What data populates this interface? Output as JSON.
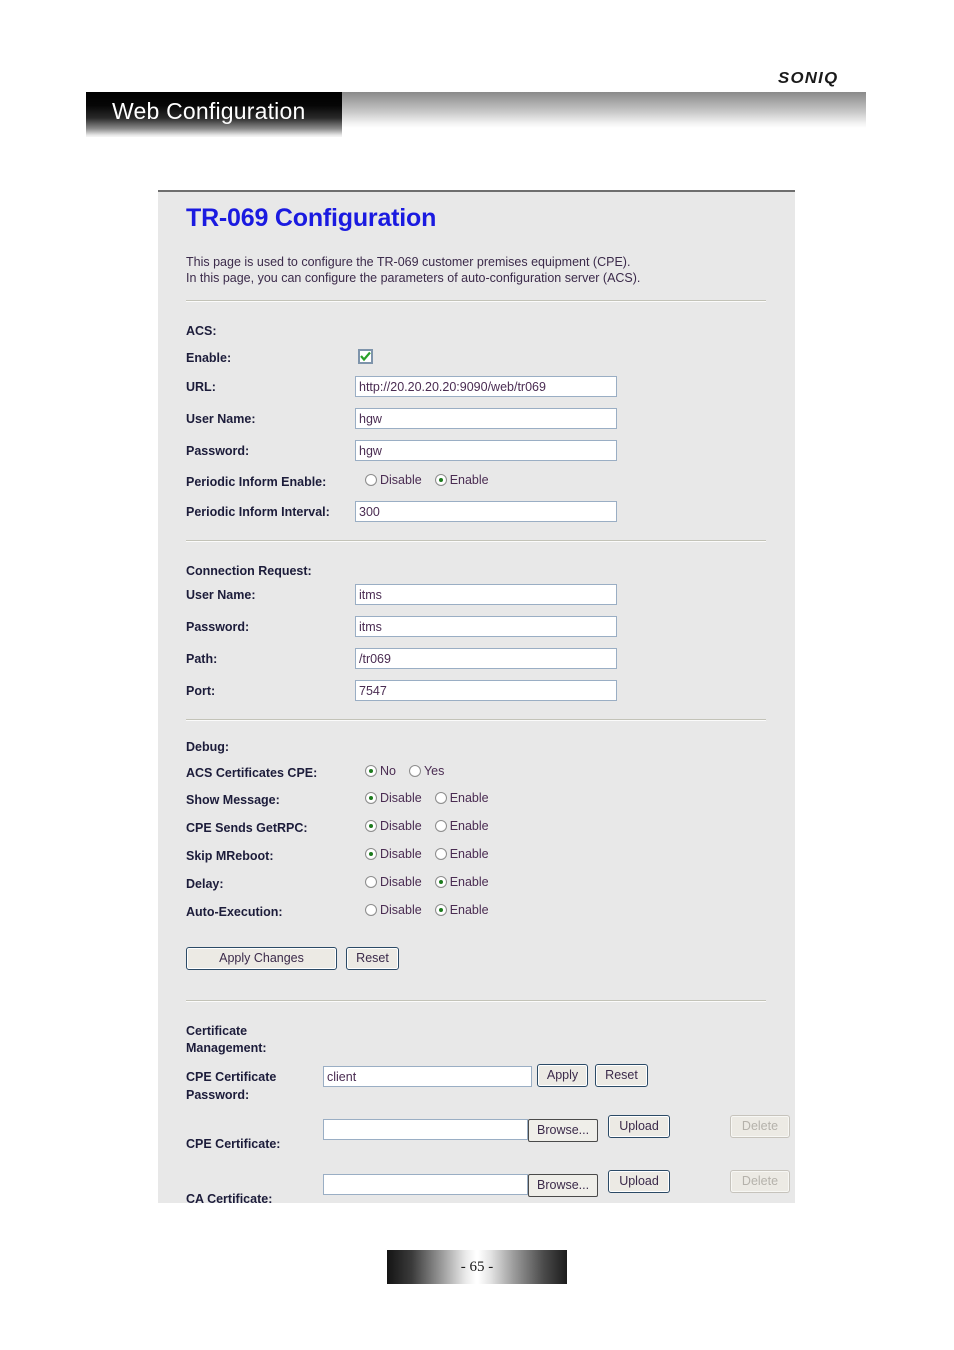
{
  "header": {
    "logo_text": "SONIQ",
    "banner_title": "Web Configuration"
  },
  "page": {
    "title": "TR-069 Configuration",
    "intro_line1": "This page is used to configure the TR-069 customer premises equipment (CPE).",
    "intro_line2": "In this page, you can configure the parameters of auto-configuration server (ACS)."
  },
  "acs": {
    "section_label": "ACS:",
    "enable_label": "Enable:",
    "enable_checked": true,
    "url_label": "URL:",
    "url_value": "http://20.20.20.20:9090/web/tr069",
    "username_label": "User Name:",
    "username_value": "hgw",
    "password_label": "Password:",
    "password_value": "hgw",
    "periodic_inform_enable_label": "Periodic Inform Enable:",
    "periodic_inform_enable_options": [
      "Disable",
      "Enable"
    ],
    "periodic_inform_enable_selected": "Enable",
    "periodic_inform_interval_label": "Periodic Inform Interval:",
    "periodic_inform_interval_value": "300"
  },
  "connection_request": {
    "section_label": "Connection Request:",
    "username_label": "User Name:",
    "username_value": "itms",
    "password_label": "Password:",
    "password_value": "itms",
    "path_label": "Path:",
    "path_value": "/tr069",
    "port_label": "Port:",
    "port_value": "7547"
  },
  "debug": {
    "section_label": "Debug:",
    "rows": [
      {
        "label": "ACS Certificates CPE:",
        "options": [
          "No",
          "Yes"
        ],
        "selected": "No"
      },
      {
        "label": "Show Message:",
        "options": [
          "Disable",
          "Enable"
        ],
        "selected": "Disable"
      },
      {
        "label": "CPE Sends GetRPC:",
        "options": [
          "Disable",
          "Enable"
        ],
        "selected": "Disable"
      },
      {
        "label": "Skip MReboot:",
        "options": [
          "Disable",
          "Enable"
        ],
        "selected": "Disable"
      },
      {
        "label": "Delay:",
        "options": [
          "Disable",
          "Enable"
        ],
        "selected": "Enable"
      },
      {
        "label": "Auto-Execution:",
        "options": [
          "Disable",
          "Enable"
        ],
        "selected": "Enable"
      }
    ],
    "apply_label": "Apply Changes",
    "reset_label": "Reset"
  },
  "certificate_management": {
    "section_label_line1": "Certificate",
    "section_label_line2": "Management:",
    "cpe_cert_password_label_line1": "CPE Certificate",
    "cpe_cert_password_label_line2": "Password:",
    "cpe_cert_password_value": "client",
    "cpe_cert_apply_label": "Apply",
    "cpe_cert_reset_label": "Reset",
    "cpe_certificate_label": "CPE Certificate:",
    "cpe_certificate_value": "",
    "cpe_browse_label": "Browse...",
    "cpe_upload_label": "Upload",
    "cpe_delete_label": "Delete",
    "ca_certificate_label": "CA Certificate:",
    "ca_certificate_value": "",
    "ca_browse_label": "Browse...",
    "ca_upload_label": "Upload",
    "ca_delete_label": "Delete"
  },
  "footer": {
    "page_number": "- 65 -"
  }
}
